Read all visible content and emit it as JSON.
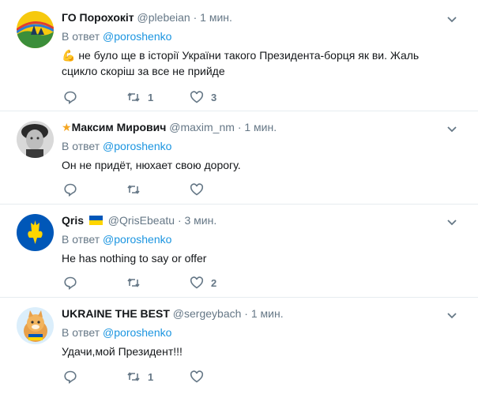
{
  "tweets": [
    {
      "name": "ГО Порохокіт",
      "handle": "@plebeian",
      "time": "1 мин.",
      "reply_prefix": "В ответ",
      "reply_to": "@poroshenko",
      "emoji": "💪",
      "text": "не було ще в історії України такого Президента-борця як ви. Жаль сцикло скоріш за все не прийде",
      "retweets": "1",
      "likes": "3",
      "replies": ""
    },
    {
      "name": "Максим Мирович",
      "prefix_icon": "★",
      "handle": "@maxim_nm",
      "time": "1 мин.",
      "reply_prefix": "В ответ",
      "reply_to": "@poroshenko",
      "text": "Он не придёт, нюхает свою дорогу.",
      "retweets": "",
      "likes": "",
      "replies": ""
    },
    {
      "name": "Qris",
      "handle": "@QrisEbeatu",
      "time": "3 мин.",
      "reply_prefix": "В ответ",
      "reply_to": "@poroshenko",
      "text": "He has nothing to say or offer",
      "retweets": "",
      "likes": "2",
      "replies": ""
    },
    {
      "name": "UKRAINE THE BEST",
      "handle": "@sergeybach",
      "time": "1 мин.",
      "reply_prefix": "В ответ",
      "reply_to": "@poroshenko",
      "text": "Удачи,мой Президент!!!",
      "retweets": "1",
      "likes": "",
      "replies": ""
    }
  ],
  "separator": "·",
  "colors": {
    "accent": "#1b95e0",
    "muted": "#657786",
    "border": "#e6ecf0"
  },
  "icons": [
    "reply-icon",
    "retweet-icon",
    "like-icon",
    "chevron-down-icon",
    "ukraine-flag-icon",
    "muscle-emoji-icon"
  ]
}
